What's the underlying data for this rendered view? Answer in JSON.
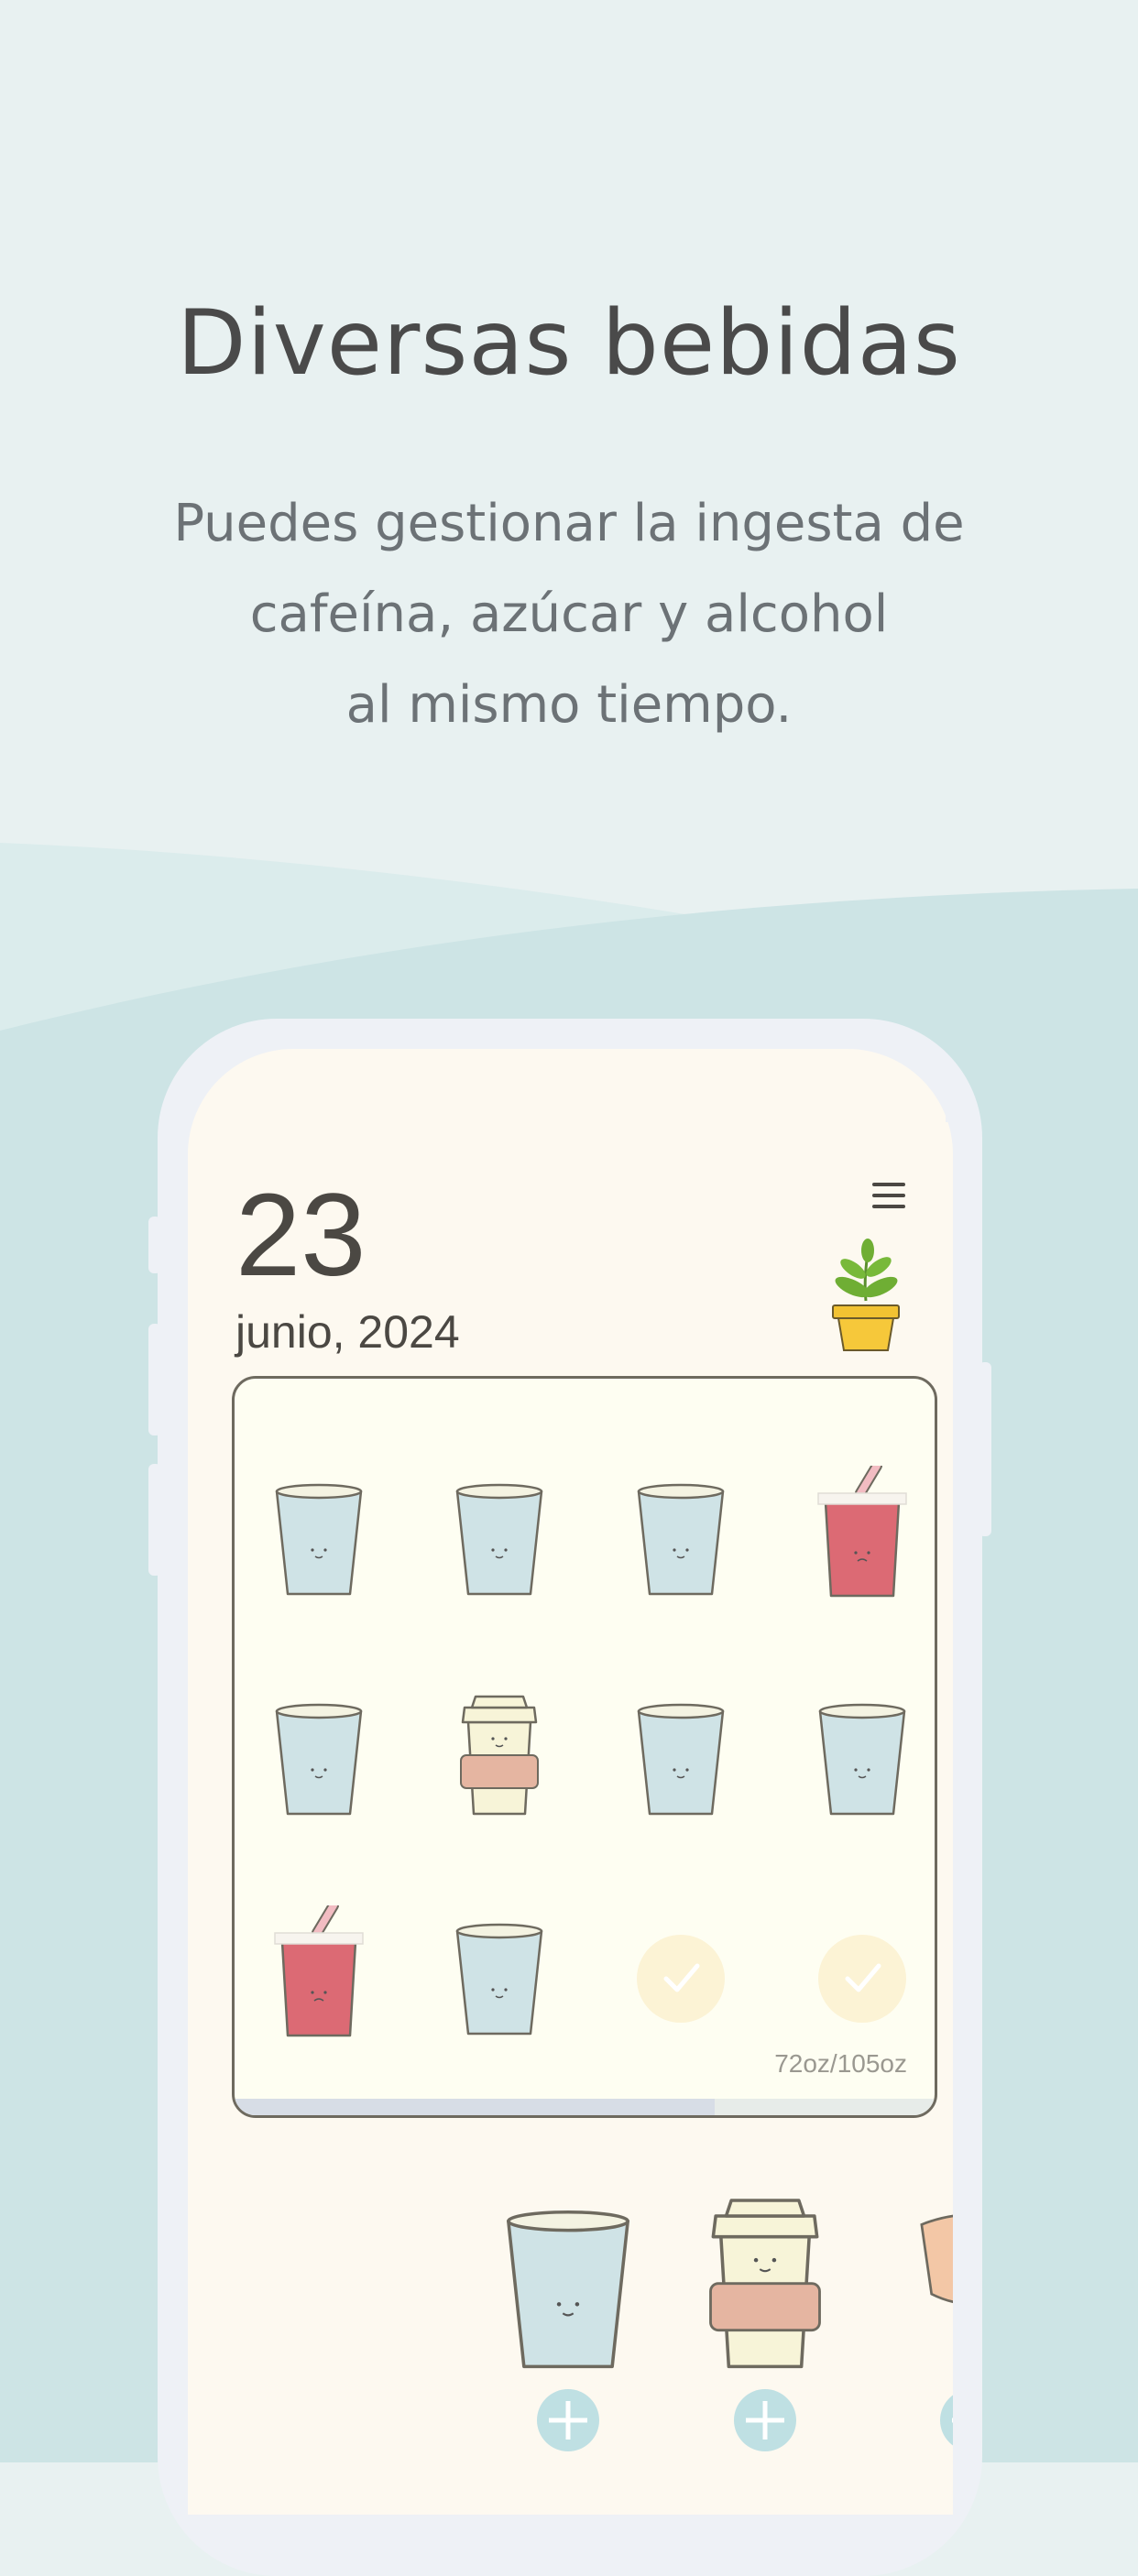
{
  "promo": {
    "title": "Diversas bebidas",
    "subtitle_lines": [
      "Puedes gestionar la ingesta de",
      "cafeína, azúcar y alcohol",
      "al mismo tiempo."
    ]
  },
  "app": {
    "day": "23",
    "month_year": "junio, 2024",
    "menu_icon": "hamburger-menu-icon",
    "plant_icon": "potted-plant-icon",
    "cups": [
      {
        "type": "water"
      },
      {
        "type": "water"
      },
      {
        "type": "water"
      },
      {
        "type": "soda"
      },
      {
        "type": "water"
      },
      {
        "type": "coffee"
      },
      {
        "type": "water"
      },
      {
        "type": "water"
      },
      {
        "type": "soda"
      },
      {
        "type": "water"
      },
      {
        "type": "goal-check"
      },
      {
        "type": "goal-check"
      }
    ],
    "progress_text": "72oz/105oz",
    "progress_fraction": 0.686,
    "picker": [
      {
        "type": "water",
        "add_icon": "plus-icon"
      },
      {
        "type": "coffee",
        "add_icon": "plus-icon"
      },
      {
        "type": "juice",
        "add_icon": "plus-icon"
      }
    ]
  },
  "colors": {
    "background": "#e8f1f1",
    "wave": "#cde4e5",
    "screen": "#fdf9f0",
    "water_cup": "#cfe3e6",
    "soda_cup": "#dc6a74",
    "coffee_sleeve": "#e5b5a1",
    "add_button": "#bfe0e3"
  }
}
